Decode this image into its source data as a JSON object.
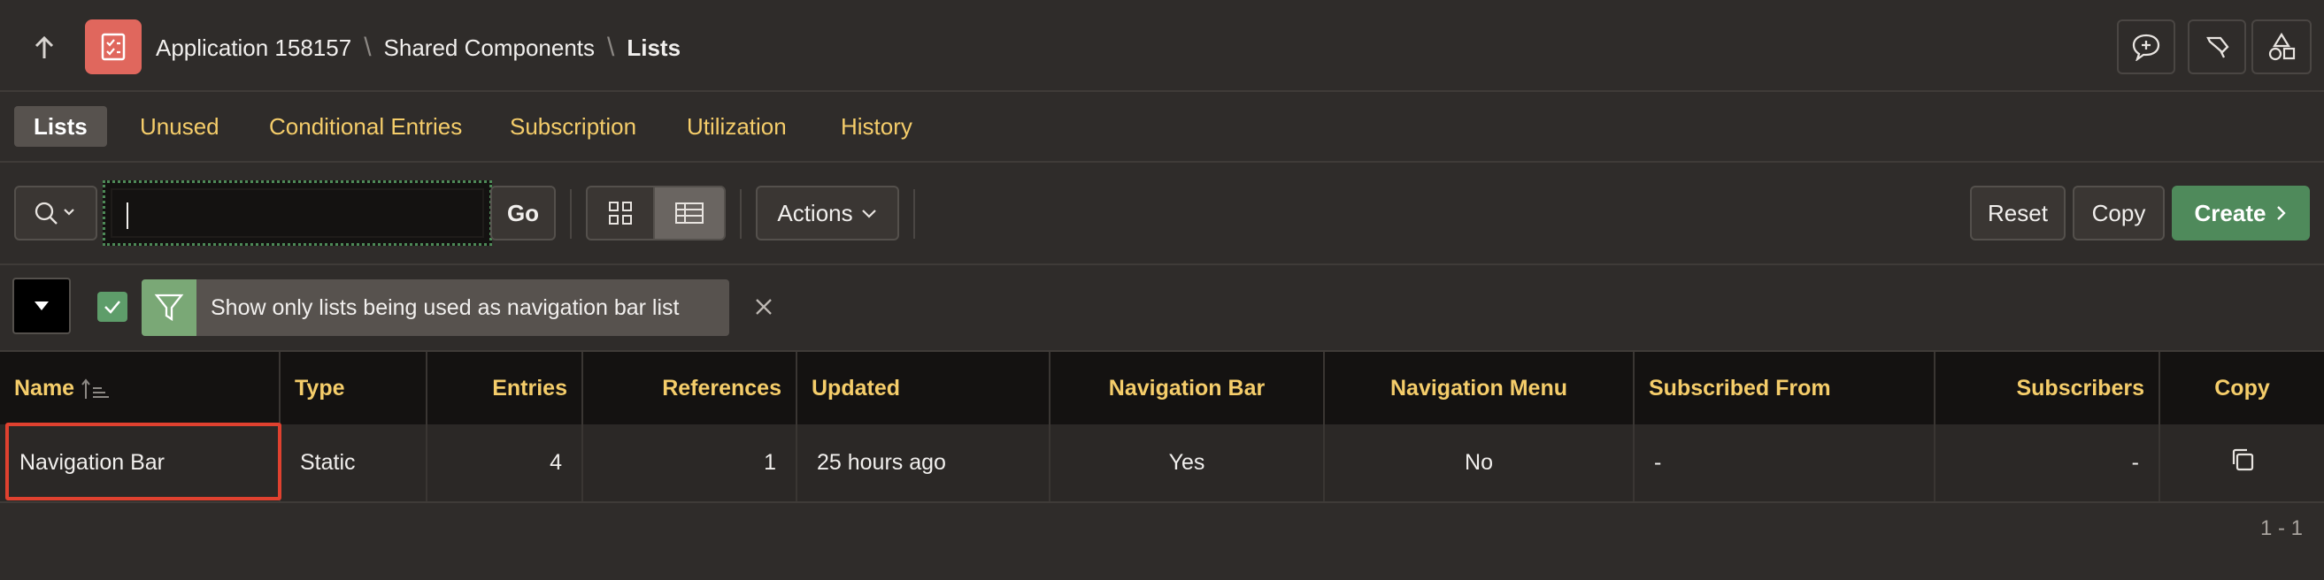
{
  "header": {
    "breadcrumb": [
      "Application 158157",
      "Shared Components",
      "Lists"
    ],
    "icons": [
      "up-arrow-icon",
      "app-checklist-icon",
      "comment-plus-icon",
      "brush-icon",
      "shapes-icon"
    ]
  },
  "tabs": [
    {
      "label": "Lists",
      "active": true
    },
    {
      "label": "Unused"
    },
    {
      "label": "Conditional Entries"
    },
    {
      "label": "Subscription"
    },
    {
      "label": "Utilization"
    },
    {
      "label": "History"
    }
  ],
  "toolbar": {
    "search_value": "",
    "go_label": "Go",
    "actions_label": "Actions",
    "reset_label": "Reset",
    "copy_label": "Copy",
    "create_label": "Create"
  },
  "filter": {
    "text": "Show only lists being used as navigation bar list",
    "checked": true
  },
  "table": {
    "columns": [
      "Name",
      "Type",
      "Entries",
      "References",
      "Updated",
      "Navigation Bar",
      "Navigation Menu",
      "Subscribed From",
      "Subscribers",
      "Copy"
    ],
    "rows": [
      {
        "name": "Navigation Bar",
        "type": "Static",
        "entries": "4",
        "references": "1",
        "updated": "25 hours ago",
        "nav_bar": "Yes",
        "nav_menu": "No",
        "subscribed_from": "-",
        "subscribers": "-"
      }
    ]
  },
  "pagination": "1 - 1",
  "colors": {
    "accent": "#f5cd6a",
    "create": "#4f8a5b",
    "app_icon": "#e0675d",
    "highlight": "#e0412f"
  }
}
